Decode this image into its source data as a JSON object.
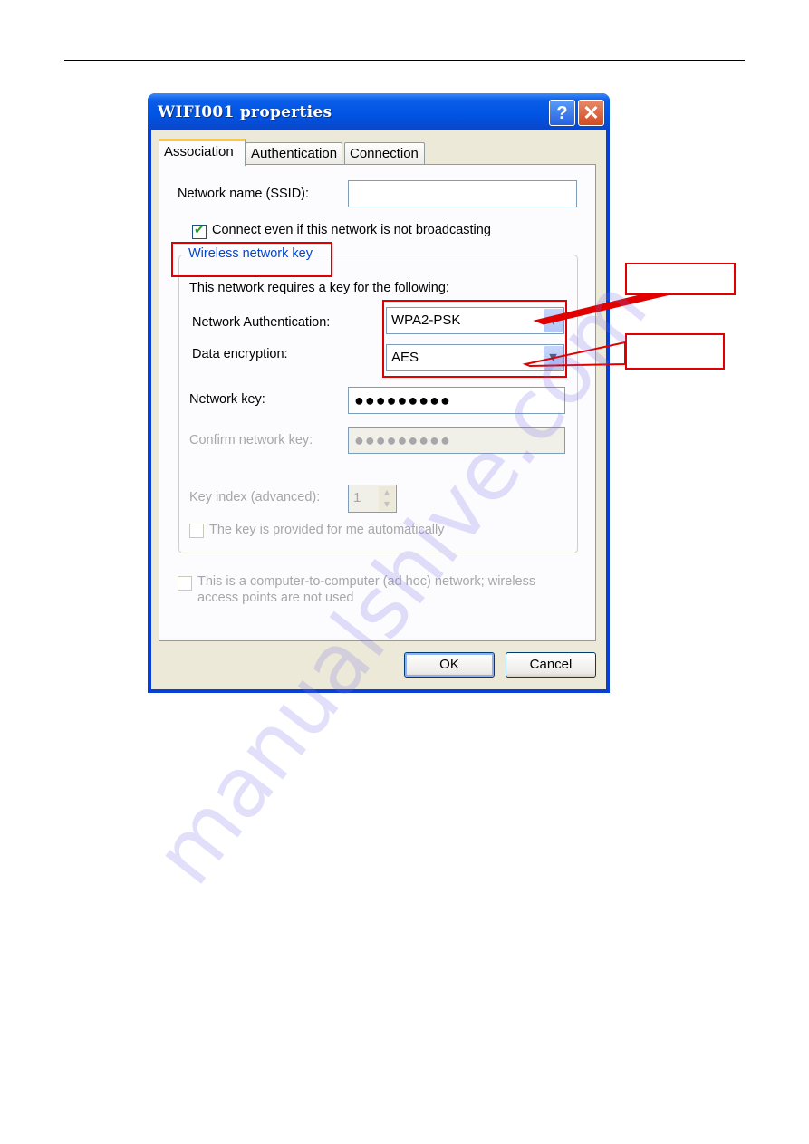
{
  "page": {
    "watermark": "manualshive.com"
  },
  "window": {
    "title": "WIFI001 properties",
    "help_label": "?",
    "close_label": "✕"
  },
  "tabs": [
    {
      "label": "Association",
      "active": true
    },
    {
      "label": "Authentication",
      "active": false
    },
    {
      "label": "Connection",
      "active": false
    }
  ],
  "association": {
    "ssid_label": "Network name (SSID):",
    "ssid_value": "",
    "broadcast_checkbox": {
      "label": "Connect even if this network is not broadcasting",
      "checked": true
    },
    "key_group": {
      "title": "Wireless network key",
      "requirement_text": "This network requires a key for the following:",
      "auth_label": "Network Authentication:",
      "auth_value": "WPA2-PSK",
      "encryption_label": "Data encryption:",
      "encryption_value": "AES",
      "network_key_label": "Network key:",
      "network_key_value": "●●●●●●●●●",
      "confirm_key_label": "Confirm network key:",
      "confirm_key_value": "●●●●●●●●●",
      "key_index_label": "Key index (advanced):",
      "key_index_value": "1",
      "auto_key_checkbox": {
        "label": "The key is provided for me automatically",
        "checked": false,
        "disabled": true
      }
    },
    "adhoc_checkbox": {
      "line1": "This is a computer-to-computer (ad hoc) network; wireless",
      "line2": "access points are not used",
      "checked": false,
      "disabled": true
    }
  },
  "buttons": {
    "ok": "OK",
    "cancel": "Cancel"
  },
  "annotations": {
    "highlight_color": "#e00000",
    "callout_1_text": "",
    "callout_2_text": ""
  }
}
